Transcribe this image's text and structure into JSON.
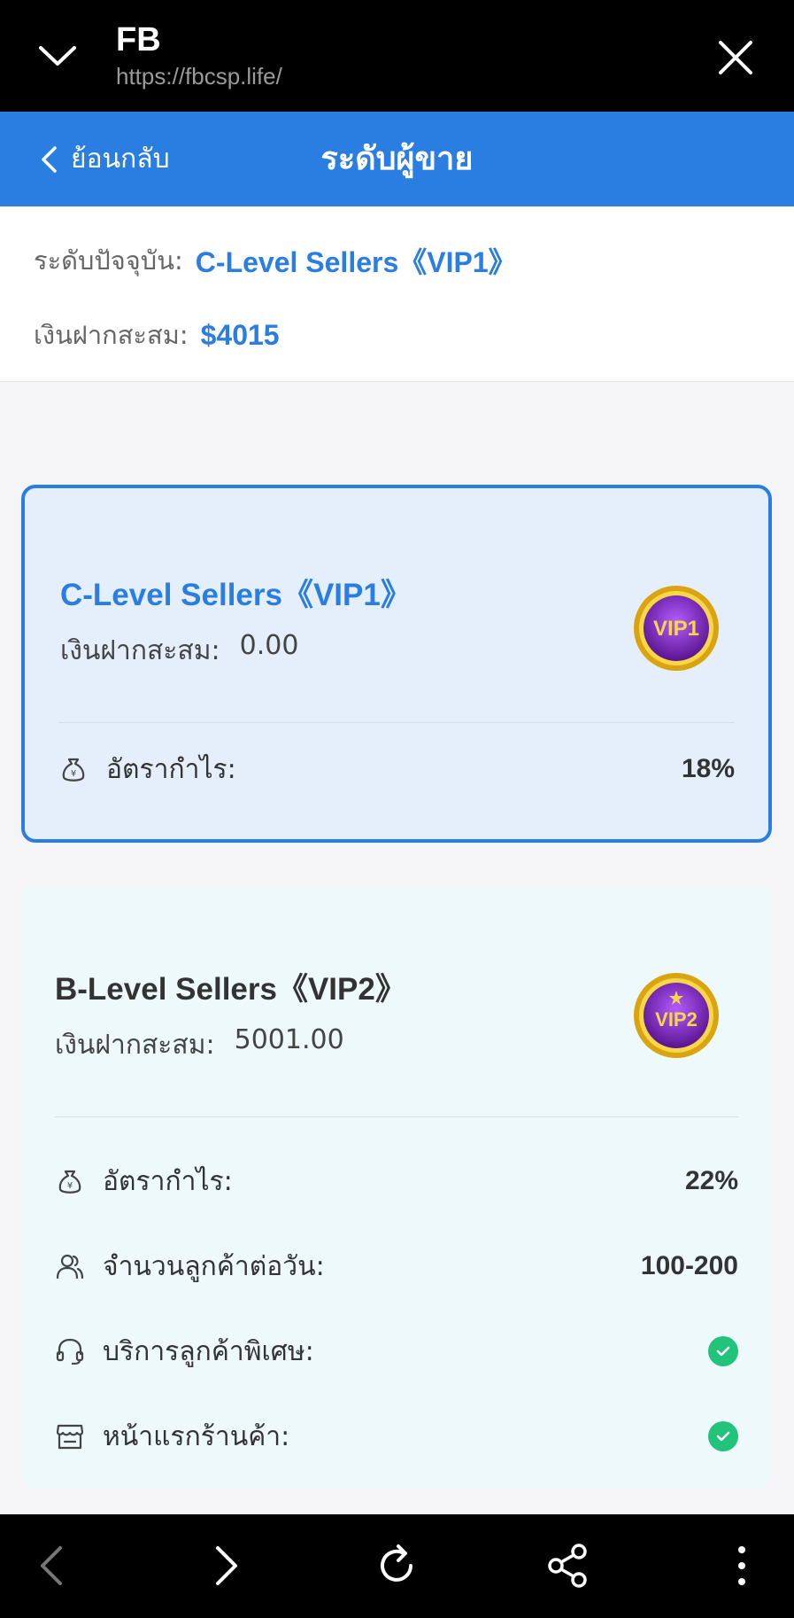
{
  "browser": {
    "title": "FB",
    "url": "https://fbcsp.life/"
  },
  "header": {
    "back_label": "ย้อนกลับ",
    "page_title": "ระดับผู้ขาย"
  },
  "summary": {
    "current_level_label": "ระดับปัจจุบัน:",
    "current_level_value": "C-Level Sellers《VIP1》",
    "deposit_label": "เงินฝากสะสม:",
    "deposit_value": "$4015"
  },
  "levels": [
    {
      "name": "C-Level Sellers《VIP1》",
      "deposit_label": "เงินฝากสะสม:",
      "deposit_value": "0.00",
      "badge_text": "VIP1",
      "selected": true,
      "features": [
        {
          "icon": "money-bag-icon",
          "label": "อัตรากำไร:",
          "value": "18%"
        }
      ]
    },
    {
      "name": "B-Level Sellers《VIP2》",
      "deposit_label": "เงินฝากสะสม:",
      "deposit_value": "5001.00",
      "badge_text": "VIP2",
      "selected": false,
      "features": [
        {
          "icon": "money-bag-icon",
          "label": "อัตรากำไร:",
          "value": "22%"
        },
        {
          "icon": "users-icon",
          "label": "จำนวนลูกค้าต่อวัน:",
          "value": "100-200"
        },
        {
          "icon": "headset-icon",
          "label": "บริการลูกค้าพิเศษ:",
          "value": "check"
        },
        {
          "icon": "store-icon",
          "label": "หน้าแรกร้านค้า:",
          "value": "check"
        }
      ]
    }
  ],
  "colors": {
    "accent": "#2a7de1",
    "check": "#22c37a",
    "selected_card_bg": "#e4effb",
    "card_bg": "#eef9fc"
  }
}
